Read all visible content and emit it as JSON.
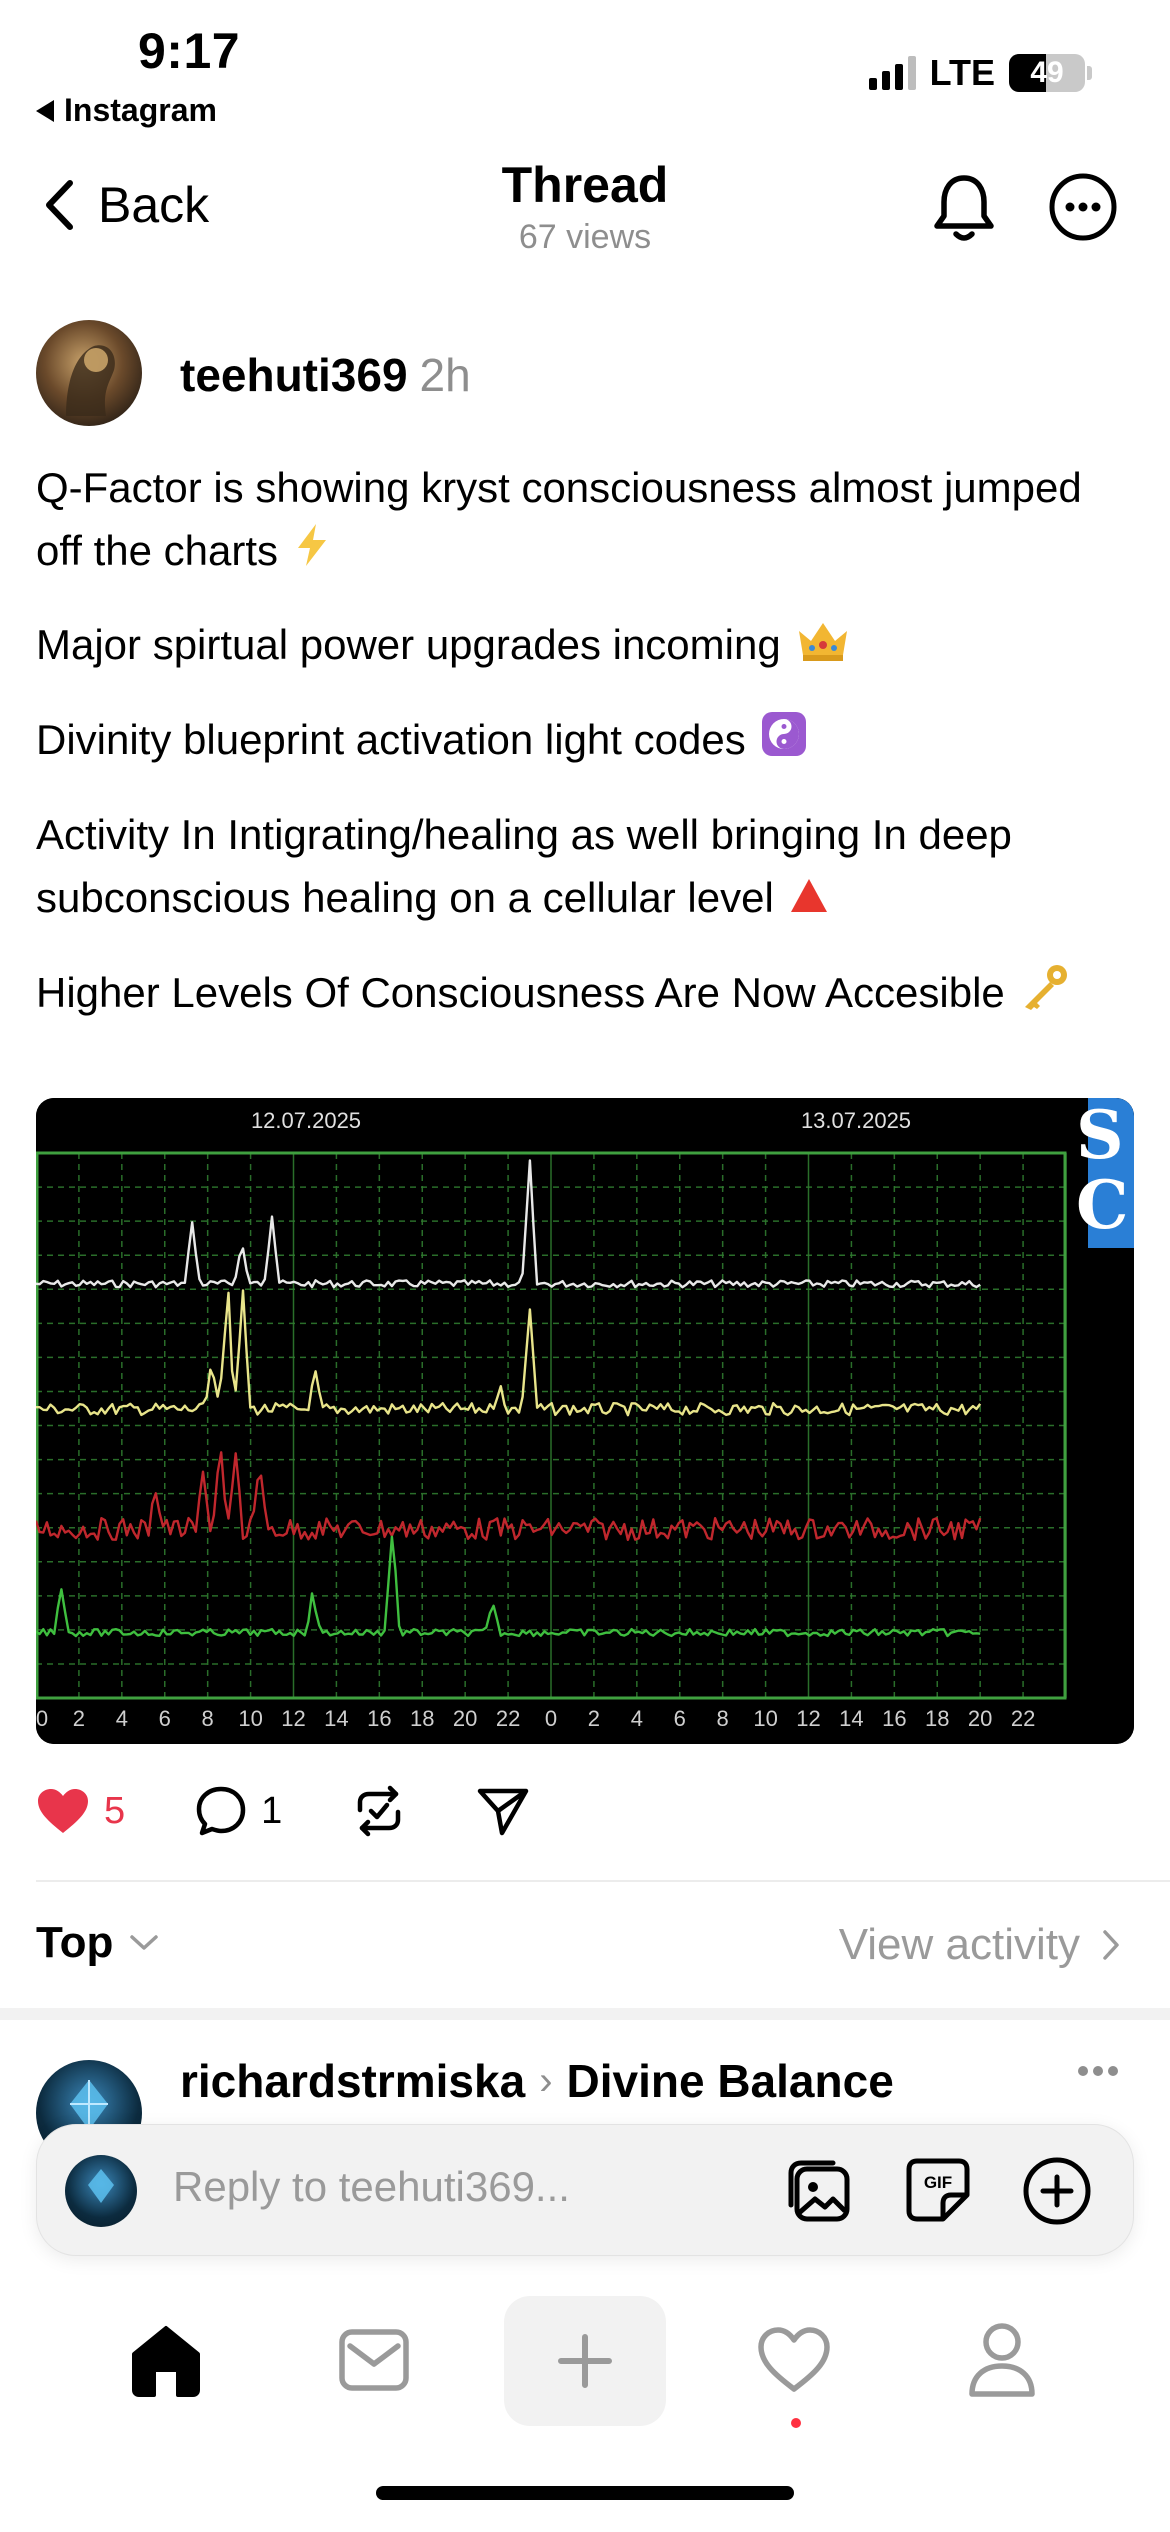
{
  "status_bar": {
    "time": "9:17",
    "back_app": "Instagram",
    "network": "LTE",
    "battery": "49",
    "battery_level": 0.49
  },
  "nav": {
    "back_label": "Back",
    "title": "Thread",
    "subtitle": "67 views"
  },
  "post": {
    "username": "teehuti369",
    "time": "2h",
    "lines": [
      "Q-Factor is showing kryst consciousness almost jumped off the charts",
      "Major spirtual power upgrades incoming",
      "Divinity blueprint activation light codes",
      "Activity In Intigrating/healing as well bringing In deep subconscious healing on a cellular level",
      "Higher Levels Of Consciousness Are Now Accesible"
    ],
    "emojis": [
      "lightning-emoji",
      "crown-emoji",
      "yin-yang-emoji",
      "red-triangle-emoji",
      "key-emoji"
    ]
  },
  "chart_data": {
    "type": "line",
    "date_labels": [
      "12.07.2025",
      "13.07.2025"
    ],
    "x_ticks": [
      "0",
      "2",
      "4",
      "6",
      "8",
      "10",
      "12",
      "14",
      "16",
      "18",
      "20",
      "22",
      "0",
      "2",
      "4",
      "6",
      "8",
      "10",
      "12",
      "14",
      "16",
      "18",
      "20",
      "22"
    ],
    "side_letters": [
      "S",
      "C"
    ],
    "background": "#000000",
    "grid_color": "#2f7a2f",
    "series": [
      {
        "color": "#e8e8e8",
        "baseline": 0.24,
        "spikes": [
          [
            7.3,
            0.11
          ],
          [
            9.6,
            0.08
          ],
          [
            11.0,
            0.12
          ],
          [
            23.0,
            0.27
          ]
        ]
      },
      {
        "color": "#e8e48a",
        "baseline": 0.47,
        "spikes": [
          [
            8.2,
            0.08
          ],
          [
            8.9,
            0.24
          ],
          [
            9.6,
            0.25
          ],
          [
            13.0,
            0.08
          ],
          [
            21.6,
            0.05
          ],
          [
            23.0,
            0.19
          ]
        ]
      },
      {
        "color": "#c0272d",
        "baseline": 0.69,
        "spikes": [
          [
            5.6,
            0.08
          ],
          [
            7.8,
            0.1
          ],
          [
            8.6,
            0.17
          ],
          [
            9.3,
            0.14
          ],
          [
            10.4,
            0.12
          ]
        ]
      },
      {
        "color": "#3fbf3f",
        "baseline": 0.88,
        "spikes": [
          [
            1.2,
            0.08
          ],
          [
            12.9,
            0.07
          ],
          [
            16.6,
            0.19
          ],
          [
            21.3,
            0.06
          ]
        ]
      }
    ]
  },
  "actions": {
    "likes": "5",
    "comments": "1"
  },
  "replies_bar": {
    "sort_label": "Top",
    "view_activity": "View activity"
  },
  "reply": {
    "username": "richardstrmiska",
    "community": "Divine Balance"
  },
  "composer": {
    "placeholder": "Reply to teehuti369..."
  },
  "tab_bar": {
    "items": [
      "home-icon",
      "inbox-icon",
      "new-post-icon",
      "activity-icon",
      "profile-icon"
    ]
  }
}
